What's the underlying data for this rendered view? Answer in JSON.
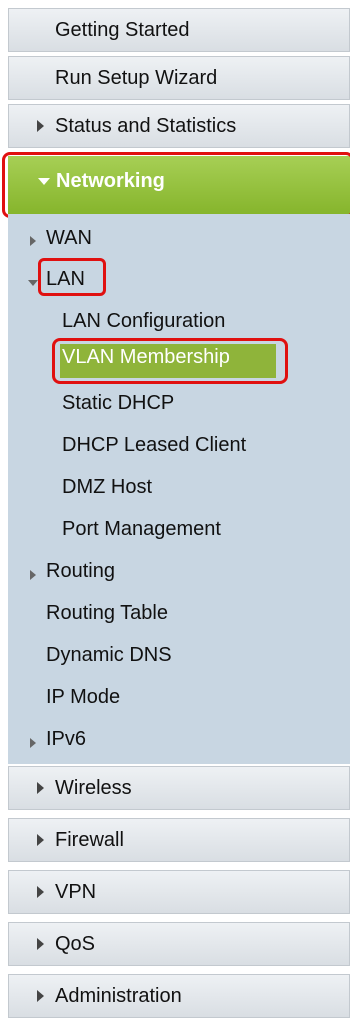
{
  "menu": {
    "getting_started": "Getting Started",
    "run_setup_wizard": "Run Setup Wizard",
    "status_and_statistics": "Status and Statistics",
    "networking": "Networking",
    "networking_items": {
      "wan": "WAN",
      "lan": "LAN",
      "lan_configuration": "LAN Configuration",
      "vlan_membership": "VLAN Membership",
      "static_dhcp": "Static DHCP",
      "dhcp_leased_client": "DHCP Leased Client",
      "dmz_host": "DMZ Host",
      "port_management": "Port Management",
      "routing": "Routing",
      "routing_table": "Routing Table",
      "dynamic_dns": "Dynamic DNS",
      "ip_mode": "IP Mode",
      "ipv6": "IPv6"
    },
    "wireless": "Wireless",
    "firewall": "Firewall",
    "vpn": "VPN",
    "qos": "QoS",
    "administration": "Administration"
  },
  "colors": {
    "active_header": "#8dbb33",
    "highlight_outline": "#e01010",
    "submenu_background": "#c8d6e2"
  }
}
